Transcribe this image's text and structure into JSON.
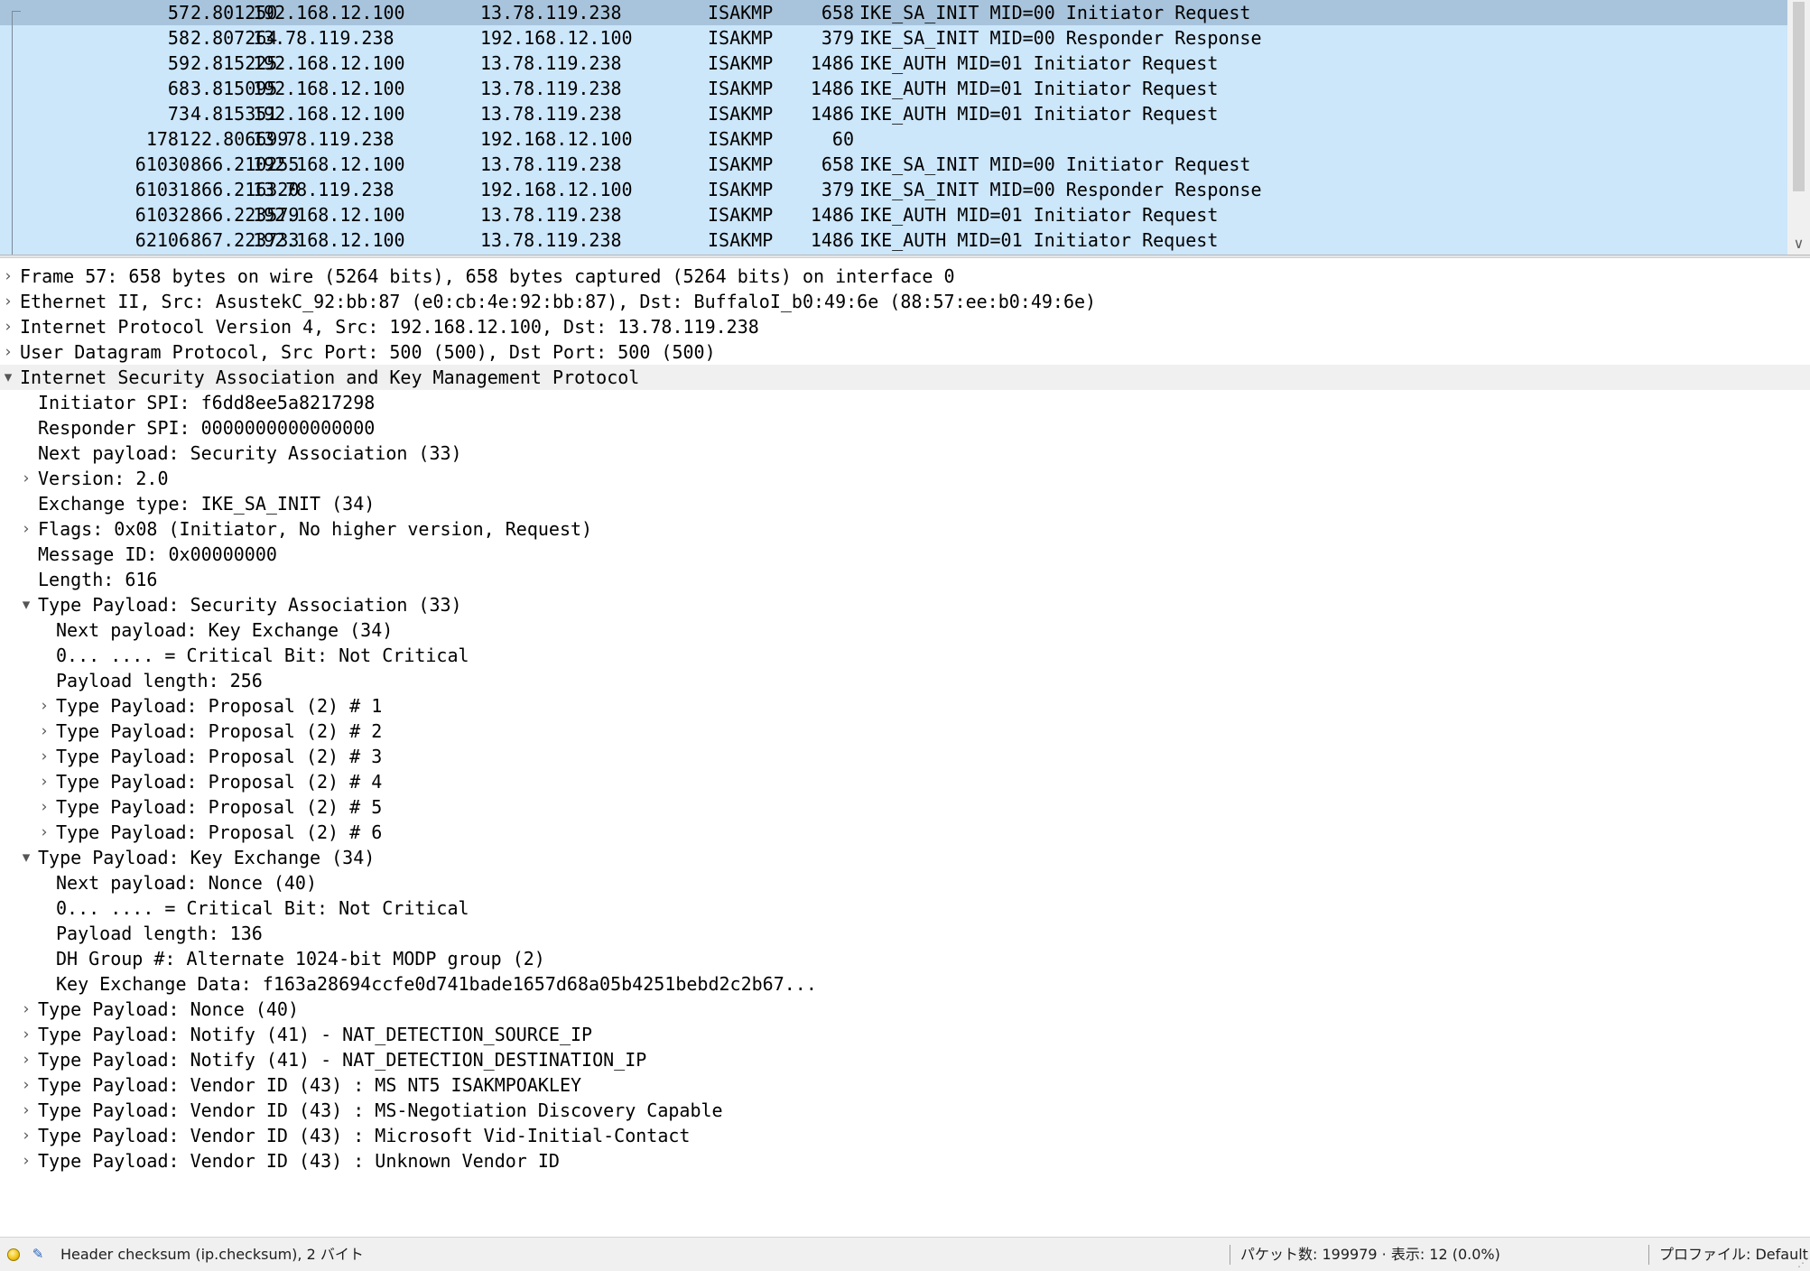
{
  "packet_list": {
    "rows": [
      {
        "no": "57",
        "time": "2.801250",
        "src": "192.168.12.100",
        "dst": "13.78.119.238",
        "proto": "ISAKMP",
        "len": "658",
        "info": "IKE_SA_INIT MID=00 Initiator Request",
        "selected": true
      },
      {
        "no": "58",
        "time": "2.807264",
        "src": "13.78.119.238",
        "dst": "192.168.12.100",
        "proto": "ISAKMP",
        "len": "379",
        "info": "IKE_SA_INIT MID=00 Responder Response",
        "selected": false
      },
      {
        "no": "59",
        "time": "2.815225",
        "src": "192.168.12.100",
        "dst": "13.78.119.238",
        "proto": "ISAKMP",
        "len": "1486",
        "info": "IKE_AUTH MID=01 Initiator Request",
        "selected": false
      },
      {
        "no": "68",
        "time": "3.815095",
        "src": "192.168.12.100",
        "dst": "13.78.119.238",
        "proto": "ISAKMP",
        "len": "1486",
        "info": "IKE_AUTH MID=01 Initiator Request",
        "selected": false
      },
      {
        "no": "73",
        "time": "4.815351",
        "src": "192.168.12.100",
        "dst": "13.78.119.238",
        "proto": "ISAKMP",
        "len": "1486",
        "info": "IKE_AUTH MID=01 Initiator Request",
        "selected": false
      },
      {
        "no": "1781",
        "time": "22.806699",
        "src": "13.78.119.238",
        "dst": "192.168.12.100",
        "proto": "ISAKMP",
        "len": "60",
        "info": "",
        "selected": false
      },
      {
        "no": "61030",
        "time": "866.210255",
        "src": "192.168.12.100",
        "dst": "13.78.119.238",
        "proto": "ISAKMP",
        "len": "658",
        "info": "IKE_SA_INIT MID=00 Initiator Request",
        "selected": false
      },
      {
        "no": "61031",
        "time": "866.216320",
        "src": "13.78.119.238",
        "dst": "192.168.12.100",
        "proto": "ISAKMP",
        "len": "379",
        "info": "IKE_SA_INIT MID=00 Responder Response",
        "selected": false
      },
      {
        "no": "61032",
        "time": "866.223579",
        "src": "192.168.12.100",
        "dst": "13.78.119.238",
        "proto": "ISAKMP",
        "len": "1486",
        "info": "IKE_AUTH MID=01 Initiator Request",
        "selected": false
      },
      {
        "no": "62106",
        "time": "867.223733",
        "src": "192.168.12.100",
        "dst": "13.78.119.238",
        "proto": "ISAKMP",
        "len": "1486",
        "info": "IKE_AUTH MID=01 Initiator Request",
        "selected": false
      }
    ]
  },
  "details": {
    "rows": [
      {
        "level": 0,
        "state": "collapsed",
        "text": "Frame 57: 658 bytes on wire (5264 bits), 658 bytes captured (5264 bits) on interface 0"
      },
      {
        "level": 0,
        "state": "collapsed",
        "text": "Ethernet II, Src: AsustekC_92:bb:87 (e0:cb:4e:92:bb:87), Dst: BuffaloI_b0:49:6e (88:57:ee:b0:49:6e)"
      },
      {
        "level": 0,
        "state": "collapsed",
        "text": "Internet Protocol Version 4, Src: 192.168.12.100, Dst: 13.78.119.238"
      },
      {
        "level": 0,
        "state": "collapsed",
        "text": "User Datagram Protocol, Src Port: 500 (500), Dst Port: 500 (500)"
      },
      {
        "level": 0,
        "state": "expanded",
        "text": "Internet Security Association and Key Management Protocol",
        "highlight": true
      },
      {
        "level": 1,
        "state": "none",
        "text": "Initiator SPI: f6dd8ee5a8217298"
      },
      {
        "level": 1,
        "state": "none",
        "text": "Responder SPI: 0000000000000000"
      },
      {
        "level": 1,
        "state": "none",
        "text": "Next payload: Security Association (33)"
      },
      {
        "level": 1,
        "state": "collapsed",
        "text": "Version: 2.0"
      },
      {
        "level": 1,
        "state": "none",
        "text": "Exchange type: IKE_SA_INIT (34)"
      },
      {
        "level": 1,
        "state": "collapsed",
        "text": "Flags: 0x08 (Initiator, No higher version, Request)"
      },
      {
        "level": 1,
        "state": "none",
        "text": "Message ID: 0x00000000"
      },
      {
        "level": 1,
        "state": "none",
        "text": "Length: 616"
      },
      {
        "level": 1,
        "state": "expanded",
        "text": "Type Payload: Security Association (33)"
      },
      {
        "level": 2,
        "state": "none",
        "text": "Next payload: Key Exchange (34)"
      },
      {
        "level": 2,
        "state": "none",
        "text": "0... .... = Critical Bit: Not Critical"
      },
      {
        "level": 2,
        "state": "none",
        "text": "Payload length: 256"
      },
      {
        "level": 2,
        "state": "collapsed",
        "text": "Type Payload: Proposal (2) # 1"
      },
      {
        "level": 2,
        "state": "collapsed",
        "text": "Type Payload: Proposal (2) # 2"
      },
      {
        "level": 2,
        "state": "collapsed",
        "text": "Type Payload: Proposal (2) # 3"
      },
      {
        "level": 2,
        "state": "collapsed",
        "text": "Type Payload: Proposal (2) # 4"
      },
      {
        "level": 2,
        "state": "collapsed",
        "text": "Type Payload: Proposal (2) # 5"
      },
      {
        "level": 2,
        "state": "collapsed",
        "text": "Type Payload: Proposal (2) # 6"
      },
      {
        "level": 1,
        "state": "expanded",
        "text": "Type Payload: Key Exchange (34)"
      },
      {
        "level": 2,
        "state": "none",
        "text": "Next payload: Nonce (40)"
      },
      {
        "level": 2,
        "state": "none",
        "text": "0... .... = Critical Bit: Not Critical"
      },
      {
        "level": 2,
        "state": "none",
        "text": "Payload length: 136"
      },
      {
        "level": 2,
        "state": "none",
        "text": "DH Group #: Alternate 1024-bit MODP group (2)"
      },
      {
        "level": 2,
        "state": "none",
        "text": "Key Exchange Data: f163a28694ccfe0d741bade1657d68a05b4251bebd2c2b67..."
      },
      {
        "level": 1,
        "state": "collapsed",
        "text": "Type Payload: Nonce (40)"
      },
      {
        "level": 1,
        "state": "collapsed",
        "text": "Type Payload: Notify (41) - NAT_DETECTION_SOURCE_IP"
      },
      {
        "level": 1,
        "state": "collapsed",
        "text": "Type Payload: Notify (41) - NAT_DETECTION_DESTINATION_IP"
      },
      {
        "level": 1,
        "state": "collapsed",
        "text": "Type Payload: Vendor ID (43) : MS NT5 ISAKMPOAKLEY"
      },
      {
        "level": 1,
        "state": "collapsed",
        "text": "Type Payload: Vendor ID (43) : MS-Negotiation Discovery Capable"
      },
      {
        "level": 1,
        "state": "collapsed",
        "text": "Type Payload: Vendor ID (43) : Microsoft Vid-Initial-Contact"
      },
      {
        "level": 1,
        "state": "collapsed",
        "text": "Type Payload: Vendor ID (43) : Unknown Vendor ID"
      }
    ]
  },
  "statusbar": {
    "field_info": "Header checksum (ip.checksum), 2 バイト",
    "packets": "パケット数: 199979 · 表示: 12 (0.0%)",
    "profile": "プロファイル: Default",
    "status_icon": "ready-indicator-icon",
    "edit_icon": "edit-comment-icon"
  },
  "icons": {
    "expanded": "▾",
    "collapsed": "›",
    "scroll_down": "∨",
    "edit": "✎",
    "grip": "⋰"
  },
  "colors": {
    "list_background": "#cce6fa",
    "selected_row": "#a8c4dc",
    "tree_highlight": "#f0f0f0"
  }
}
